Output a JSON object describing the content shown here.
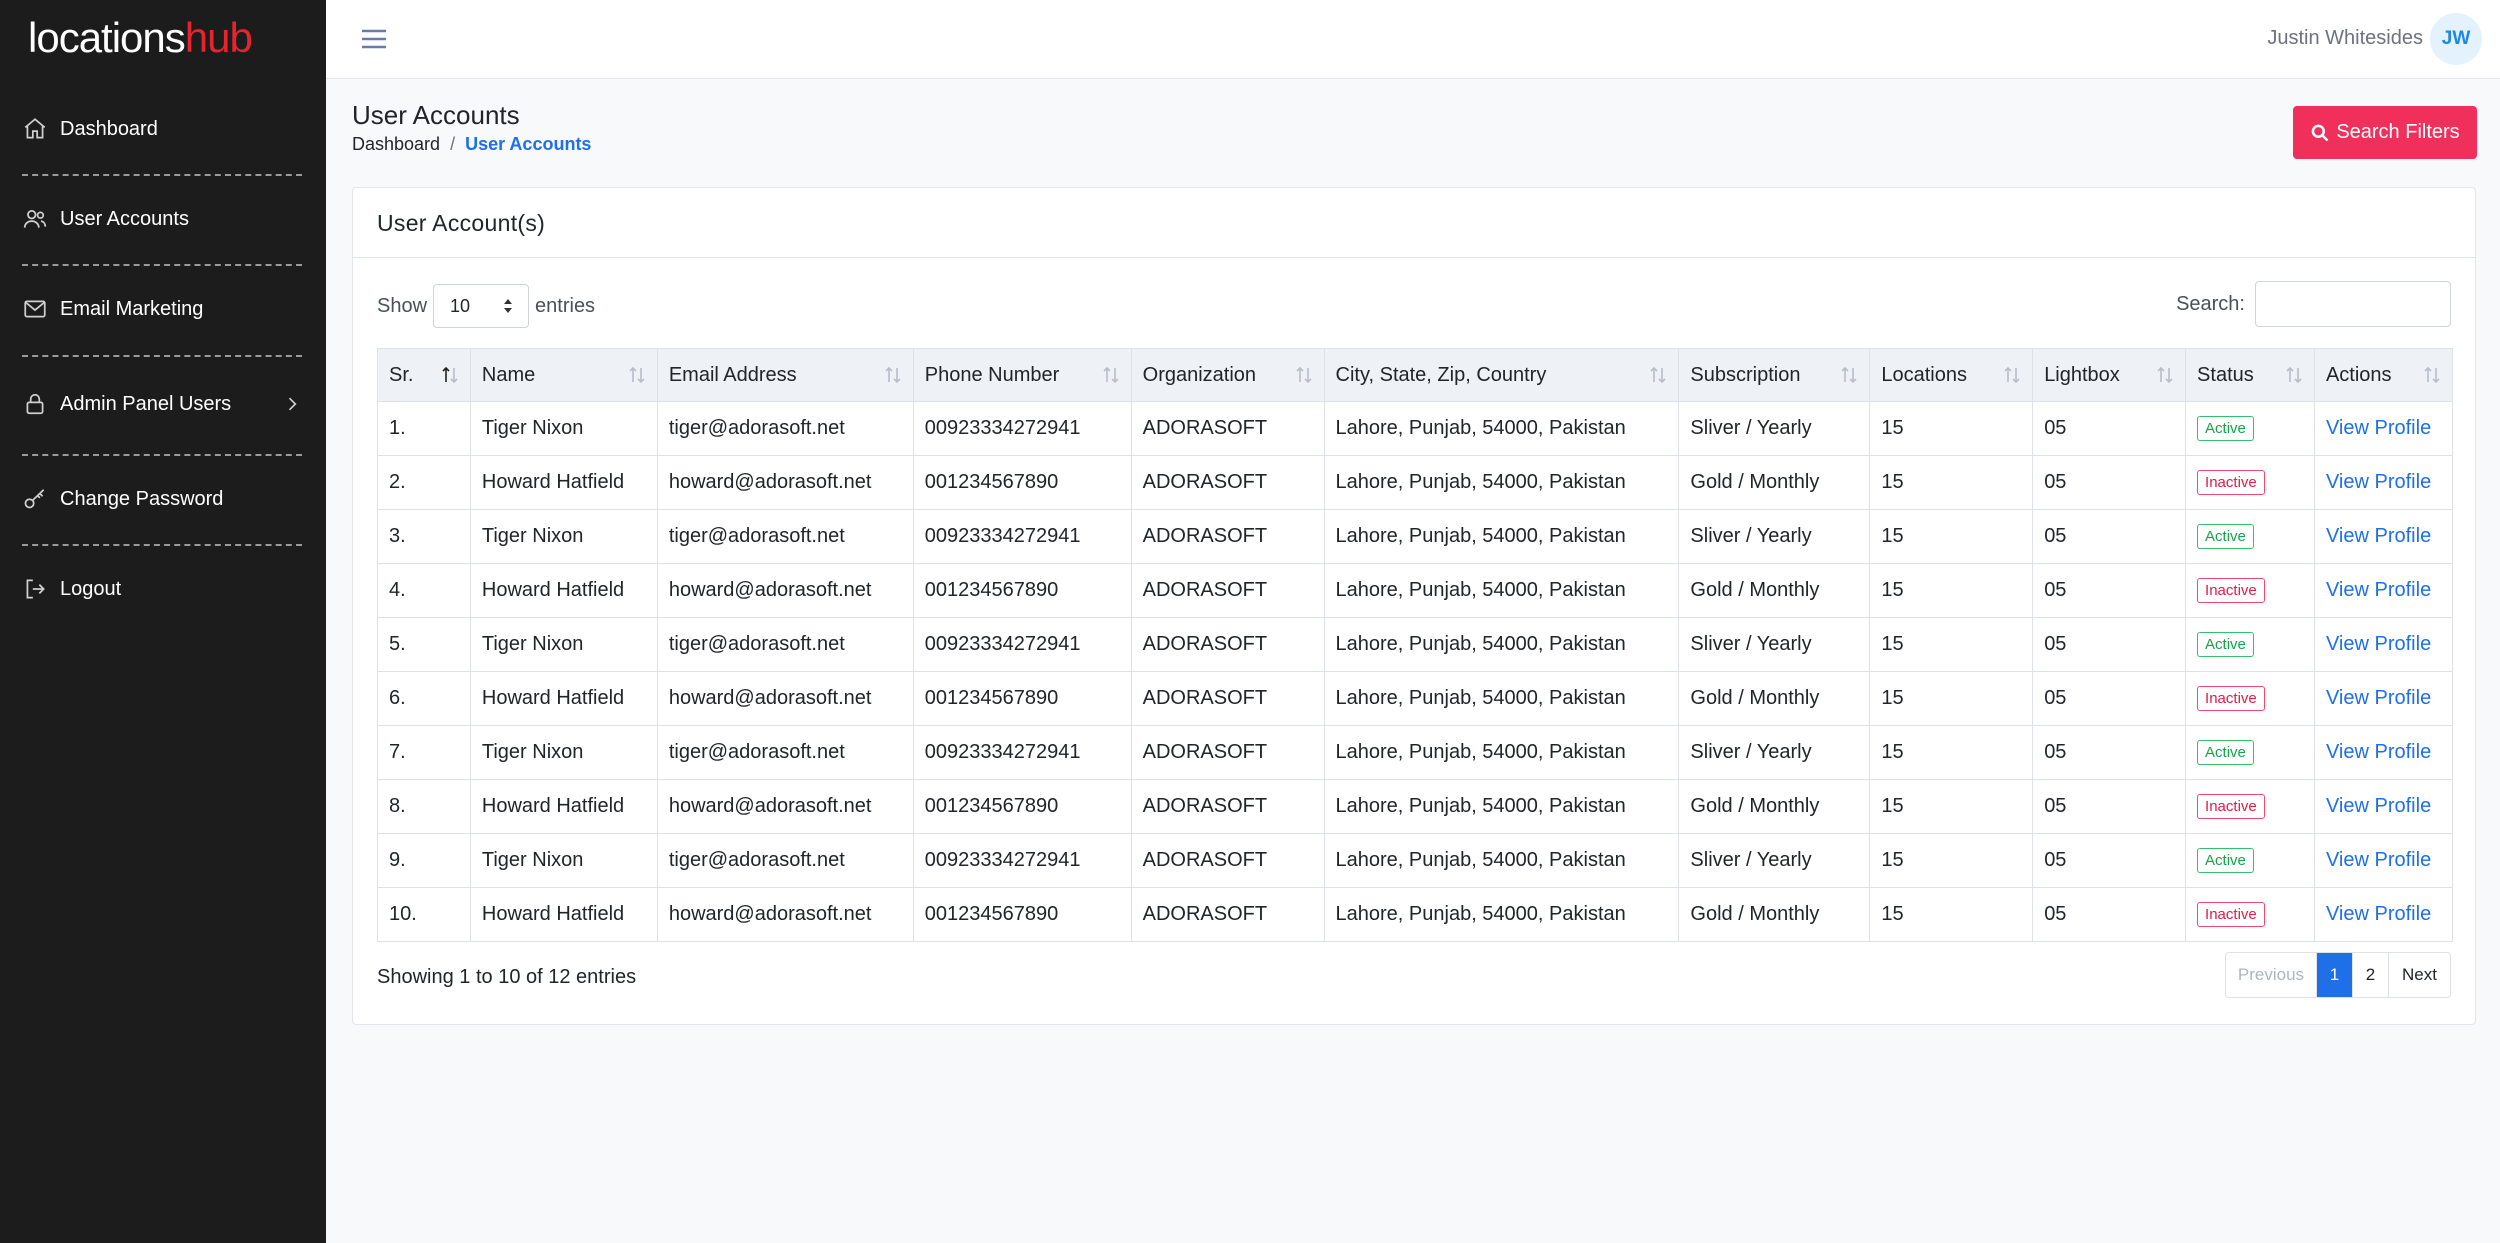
{
  "brand": {
    "part1": "locations",
    "part2": "hub",
    "accent_color": "#e5242c"
  },
  "sidebar": {
    "items": [
      {
        "label": "Dashboard",
        "icon": "home-icon"
      },
      {
        "label": "User Accounts",
        "icon": "users-icon"
      },
      {
        "label": "Email Marketing",
        "icon": "mail-icon"
      },
      {
        "label": "Admin Panel Users",
        "icon": "lock-icon",
        "has_submenu": true
      },
      {
        "label": "Change Password",
        "icon": "key-icon"
      },
      {
        "label": "Logout",
        "icon": "logout-icon"
      }
    ]
  },
  "topbar": {
    "user_name": "Justin Whitesides",
    "user_initials": "JW"
  },
  "header": {
    "title": "User Accounts",
    "breadcrumb": {
      "home": "Dashboard",
      "sep": "/",
      "current": "User Accounts"
    },
    "search_filters_label": "Search Filters"
  },
  "card": {
    "title": "User Account(s)",
    "show_label": "Show",
    "entries_value": "10",
    "entries_label": "entries",
    "search_label": "Search:",
    "search_value": ""
  },
  "table": {
    "columns": [
      "Sr.",
      "Name",
      "Email Address",
      "Phone Number",
      "Organization",
      "City, State, Zip, Country",
      "Subscription",
      "Locations",
      "Lightbox",
      "Status",
      "Actions"
    ],
    "rows": [
      {
        "sr": "1.",
        "name": "Tiger Nixon",
        "email": "tiger@adorasoft.net",
        "phone": "00923334272941",
        "org": "ADORASOFT",
        "city": "Lahore, Punjab, 54000, Pakistan",
        "subscription": "Sliver / Yearly",
        "locations": "15",
        "lightbox": "05",
        "status": "Active",
        "action": "View Profile"
      },
      {
        "sr": "2.",
        "name": "Howard Hatfield",
        "email": "howard@adorasoft.net",
        "phone": "001234567890",
        "org": "ADORASOFT",
        "city": "Lahore, Punjab, 54000, Pakistan",
        "subscription": "Gold / Monthly",
        "locations": "15",
        "lightbox": "05",
        "status": "Inactive",
        "action": "View Profile"
      },
      {
        "sr": "3.",
        "name": "Tiger Nixon",
        "email": "tiger@adorasoft.net",
        "phone": "00923334272941",
        "org": "ADORASOFT",
        "city": "Lahore, Punjab, 54000, Pakistan",
        "subscription": "Sliver / Yearly",
        "locations": "15",
        "lightbox": "05",
        "status": "Active",
        "action": "View Profile"
      },
      {
        "sr": "4.",
        "name": "Howard Hatfield",
        "email": "howard@adorasoft.net",
        "phone": "001234567890",
        "org": "ADORASOFT",
        "city": "Lahore, Punjab, 54000, Pakistan",
        "subscription": "Gold / Monthly",
        "locations": "15",
        "lightbox": "05",
        "status": "Inactive",
        "action": "View Profile"
      },
      {
        "sr": "5.",
        "name": "Tiger Nixon",
        "email": "tiger@adorasoft.net",
        "phone": "00923334272941",
        "org": "ADORASOFT",
        "city": "Lahore, Punjab, 54000, Pakistan",
        "subscription": "Sliver / Yearly",
        "locations": "15",
        "lightbox": "05",
        "status": "Active",
        "action": "View Profile"
      },
      {
        "sr": "6.",
        "name": "Howard Hatfield",
        "email": "howard@adorasoft.net",
        "phone": "001234567890",
        "org": "ADORASOFT",
        "city": "Lahore, Punjab, 54000, Pakistan",
        "subscription": "Gold / Monthly",
        "locations": "15",
        "lightbox": "05",
        "status": "Inactive",
        "action": "View Profile"
      },
      {
        "sr": "7.",
        "name": "Tiger Nixon",
        "email": "tiger@adorasoft.net",
        "phone": "00923334272941",
        "org": "ADORASOFT",
        "city": "Lahore, Punjab, 54000, Pakistan",
        "subscription": "Sliver / Yearly",
        "locations": "15",
        "lightbox": "05",
        "status": "Active",
        "action": "View Profile"
      },
      {
        "sr": "8.",
        "name": "Howard Hatfield",
        "email": "howard@adorasoft.net",
        "phone": "001234567890",
        "org": "ADORASOFT",
        "city": "Lahore, Punjab, 54000, Pakistan",
        "subscription": "Gold / Monthly",
        "locations": "15",
        "lightbox": "05",
        "status": "Inactive",
        "action": "View Profile"
      },
      {
        "sr": "9.",
        "name": "Tiger Nixon",
        "email": "tiger@adorasoft.net",
        "phone": "00923334272941",
        "org": "ADORASOFT",
        "city": "Lahore, Punjab, 54000, Pakistan",
        "subscription": "Sliver / Yearly",
        "locations": "15",
        "lightbox": "05",
        "status": "Active",
        "action": "View Profile"
      },
      {
        "sr": "10.",
        "name": "Howard Hatfield",
        "email": "howard@adorasoft.net",
        "phone": "001234567890",
        "org": "ADORASOFT",
        "city": "Lahore, Punjab, 54000, Pakistan",
        "subscription": "Gold / Monthly",
        "locations": "15",
        "lightbox": "05",
        "status": "Inactive",
        "action": "View Profile"
      }
    ]
  },
  "footer": {
    "showing_text": "Showing 1 to 10 of 12 entries",
    "pagination": {
      "previous": "Previous",
      "pages": [
        "1",
        "2"
      ],
      "current": "1",
      "next": "Next"
    }
  },
  "colors": {
    "sidebar_bg": "#1c1c1c",
    "primary": "#1e6fe8",
    "danger_button": "#f0305a",
    "active_badge": "#16a34a",
    "inactive_badge": "#e11d48"
  }
}
